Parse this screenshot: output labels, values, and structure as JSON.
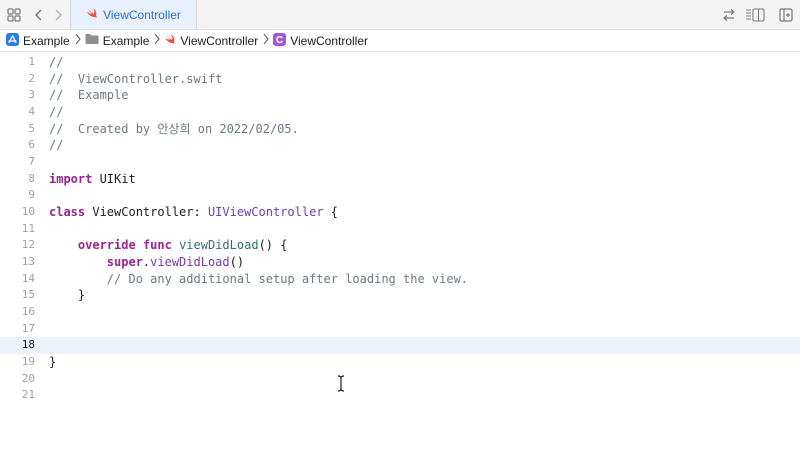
{
  "tabs": [
    {
      "label": "ViewController",
      "icon": "swift-icon",
      "active": true
    }
  ],
  "toolbar": {
    "left_icons": [
      "grid-icon",
      "back-chevron-icon",
      "forward-chevron-icon"
    ],
    "right_icons": [
      "swap-arrows-icon",
      "editor-options-icon",
      "add-editor-icon"
    ]
  },
  "breadcrumb": [
    {
      "label": "Example",
      "icon": "app-project-icon"
    },
    {
      "label": "Example",
      "icon": "folder-icon"
    },
    {
      "label": "ViewController",
      "icon": "swift-icon"
    },
    {
      "label": "ViewController",
      "icon": "class-c-icon"
    }
  ],
  "colors": {
    "tab_active_bg": "#e8f1fd",
    "tab_active_text": "#2e6fd9",
    "swift_orange": "#f05138",
    "class_purple": "#a05bd1",
    "app_blue": "#2c7be5",
    "keyword": "#9b2393",
    "type": "#703daa",
    "function": "#326d74",
    "comment": "#6c7986",
    "current_line_bg": "#edf3fc"
  },
  "editor": {
    "current_line": 18,
    "lines": [
      {
        "num": "1",
        "tokens": [
          {
            "t": "//",
            "c": "comment"
          }
        ]
      },
      {
        "num": "2",
        "tokens": [
          {
            "t": "//  ViewController.swift",
            "c": "comment"
          }
        ]
      },
      {
        "num": "3",
        "tokens": [
          {
            "t": "//  Example",
            "c": "comment"
          }
        ]
      },
      {
        "num": "4",
        "tokens": [
          {
            "t": "//",
            "c": "comment"
          }
        ]
      },
      {
        "num": "5",
        "tokens": [
          {
            "t": "//  Created by 안상희 on 2022/02/05.",
            "c": "comment"
          }
        ]
      },
      {
        "num": "6",
        "tokens": [
          {
            "t": "//",
            "c": "comment"
          }
        ]
      },
      {
        "num": "7",
        "tokens": []
      },
      {
        "num": "8",
        "tokens": [
          {
            "t": "import",
            "c": "kw"
          },
          {
            "t": " UIKit",
            "c": "plain"
          }
        ]
      },
      {
        "num": "9",
        "tokens": []
      },
      {
        "num": "10",
        "tokens": [
          {
            "t": "class",
            "c": "kw"
          },
          {
            "t": " ViewController: ",
            "c": "plain"
          },
          {
            "t": "UIViewController",
            "c": "type"
          },
          {
            "t": " {",
            "c": "plain"
          }
        ]
      },
      {
        "num": "11",
        "tokens": []
      },
      {
        "num": "12",
        "tokens": [
          {
            "t": "    ",
            "c": "plain"
          },
          {
            "t": "override",
            "c": "kw"
          },
          {
            "t": " ",
            "c": "plain"
          },
          {
            "t": "func",
            "c": "kw"
          },
          {
            "t": " ",
            "c": "plain"
          },
          {
            "t": "viewDidLoad",
            "c": "func"
          },
          {
            "t": "() {",
            "c": "plain"
          }
        ]
      },
      {
        "num": "13",
        "tokens": [
          {
            "t": "        ",
            "c": "plain"
          },
          {
            "t": "super",
            "c": "kw"
          },
          {
            "t": ".",
            "c": "plain"
          },
          {
            "t": "viewDidLoad",
            "c": "type"
          },
          {
            "t": "()",
            "c": "plain"
          }
        ]
      },
      {
        "num": "14",
        "tokens": [
          {
            "t": "        // Do any additional setup after loading the view.",
            "c": "comment"
          }
        ]
      },
      {
        "num": "15",
        "tokens": [
          {
            "t": "    }",
            "c": "plain"
          }
        ]
      },
      {
        "num": "16",
        "tokens": []
      },
      {
        "num": "17",
        "tokens": []
      },
      {
        "num": "18",
        "tokens": []
      },
      {
        "num": "19",
        "tokens": [
          {
            "t": "}",
            "c": "plain"
          }
        ]
      },
      {
        "num": "20",
        "tokens": []
      },
      {
        "num": "21",
        "tokens": []
      }
    ]
  }
}
